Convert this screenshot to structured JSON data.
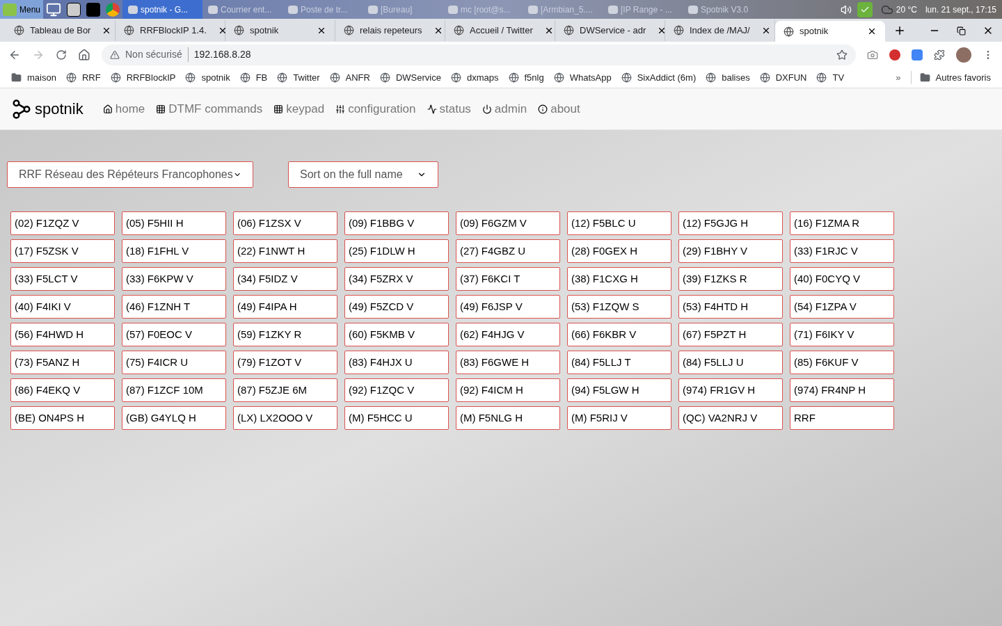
{
  "taskbar": {
    "menu": "Menu",
    "windows": [
      {
        "title": "spotnik - G...",
        "selected": true
      },
      {
        "title": "Courrier ent...",
        "selected": false
      },
      {
        "title": "Poste de tr...",
        "selected": false
      },
      {
        "title": "[Bureau]",
        "selected": false
      },
      {
        "title": "mc [root@s...",
        "selected": false
      },
      {
        "title": "[Armbian_5....",
        "selected": false
      },
      {
        "title": "[IP Range - ...",
        "selected": false
      },
      {
        "title": "Spotnik V3.0",
        "selected": false
      }
    ],
    "weather": "20 °C",
    "clock": "lun. 21 sept., 17:15"
  },
  "tabs": [
    {
      "title": "Tableau de Bor",
      "selected": false
    },
    {
      "title": "RRFBlockIP 1.4.",
      "selected": false
    },
    {
      "title": "spotnik",
      "selected": false
    },
    {
      "title": "relais repeteurs",
      "selected": false
    },
    {
      "title": "Accueil / Twitter",
      "selected": false
    },
    {
      "title": "DWService - adr",
      "selected": false
    },
    {
      "title": "Index de /MAJ/",
      "selected": false
    },
    {
      "title": "spotnik",
      "selected": true
    }
  ],
  "address_bar": {
    "security": "Non sécurisé",
    "url": "192.168.8.28"
  },
  "bookmarks": [
    {
      "kind": "folder",
      "label": "maison"
    },
    {
      "kind": "link",
      "label": "RRF"
    },
    {
      "kind": "link",
      "label": "RRFBlockIP"
    },
    {
      "kind": "link",
      "label": "spotnik"
    },
    {
      "kind": "link",
      "label": "FB"
    },
    {
      "kind": "link",
      "label": "Twitter"
    },
    {
      "kind": "link",
      "label": "ANFR"
    },
    {
      "kind": "link",
      "label": "DWService"
    },
    {
      "kind": "link",
      "label": "dxmaps"
    },
    {
      "kind": "link",
      "label": "f5nlg"
    },
    {
      "kind": "link",
      "label": "WhatsApp"
    },
    {
      "kind": "link",
      "label": "SixAddict (6m)"
    },
    {
      "kind": "link",
      "label": "balises"
    },
    {
      "kind": "link",
      "label": "DXFUN"
    },
    {
      "kind": "link",
      "label": "TV"
    }
  ],
  "bookmarks_more": "»",
  "other_bookmarks": "Autres favoris",
  "nav": {
    "brand": "spotnik",
    "items": [
      "home",
      "DTMF commands",
      "keypad",
      "configuration",
      "status",
      "admin",
      "about"
    ]
  },
  "network_select": "RRF Réseau des Répéteurs Francophones",
  "sort_select": "Sort on the full name",
  "relays": [
    "(02) F1ZQZ V",
    "(05) F5HII H",
    "(06) F1ZSX V",
    "(09) F1BBG V",
    "(09) F6GZM V",
    "(12) F5BLC U",
    "(12) F5GJG H",
    "(16) F1ZMA R",
    "(17) F5ZSK V",
    "(18) F1FHL V",
    "(22) F1NWT H",
    "(25) F1DLW H",
    "(27) F4GBZ U",
    "(28) F0GEX H",
    "(29) F1BHY V",
    "(33) F1RJC V",
    "(33) F5LCT V",
    "(33) F6KPW V",
    "(34) F5IDZ V",
    "(34) F5ZRX V",
    "(37) F6KCI T",
    "(38) F1CXG H",
    "(39) F1ZKS R",
    "(40) F0CYQ V",
    "(40) F4IKI V",
    "(46) F1ZNH T",
    "(49) F4IPA H",
    "(49) F5ZCD V",
    "(49) F6JSP V",
    "(53) F1ZQW S",
    "(53) F4HTD H",
    "(54) F1ZPA V",
    "(56) F4HWD H",
    "(57) F0EOC V",
    "(59) F1ZKY R",
    "(60) F5KMB V",
    "(62) F4HJG V",
    "(66) F6KBR V",
    "(67) F5PZT H",
    "(71) F6IKY V",
    "(73) F5ANZ H",
    "(75) F4ICR U",
    "(79) F1ZOT V",
    "(83) F4HJX U",
    "(83) F6GWE H",
    "(84) F5LLJ T",
    "(84) F5LLJ U",
    "(85) F6KUF V",
    "(86) F4EKQ V",
    "(87) F1ZCF 10M",
    "(87) F5ZJE 6M",
    "(92) F1ZQC V",
    "(92) F4ICM H",
    "(94) F5LGW H",
    "(974) FR1GV H",
    "(974) FR4NP H",
    "(BE) ON4PS H",
    "(GB) G4YLQ H",
    "(LX) LX2OOO V",
    "(M) F5HCC U",
    "(M) F5NLG H",
    "(M) F5RIJ V",
    "(QC) VA2NRJ V",
    "RRF"
  ]
}
